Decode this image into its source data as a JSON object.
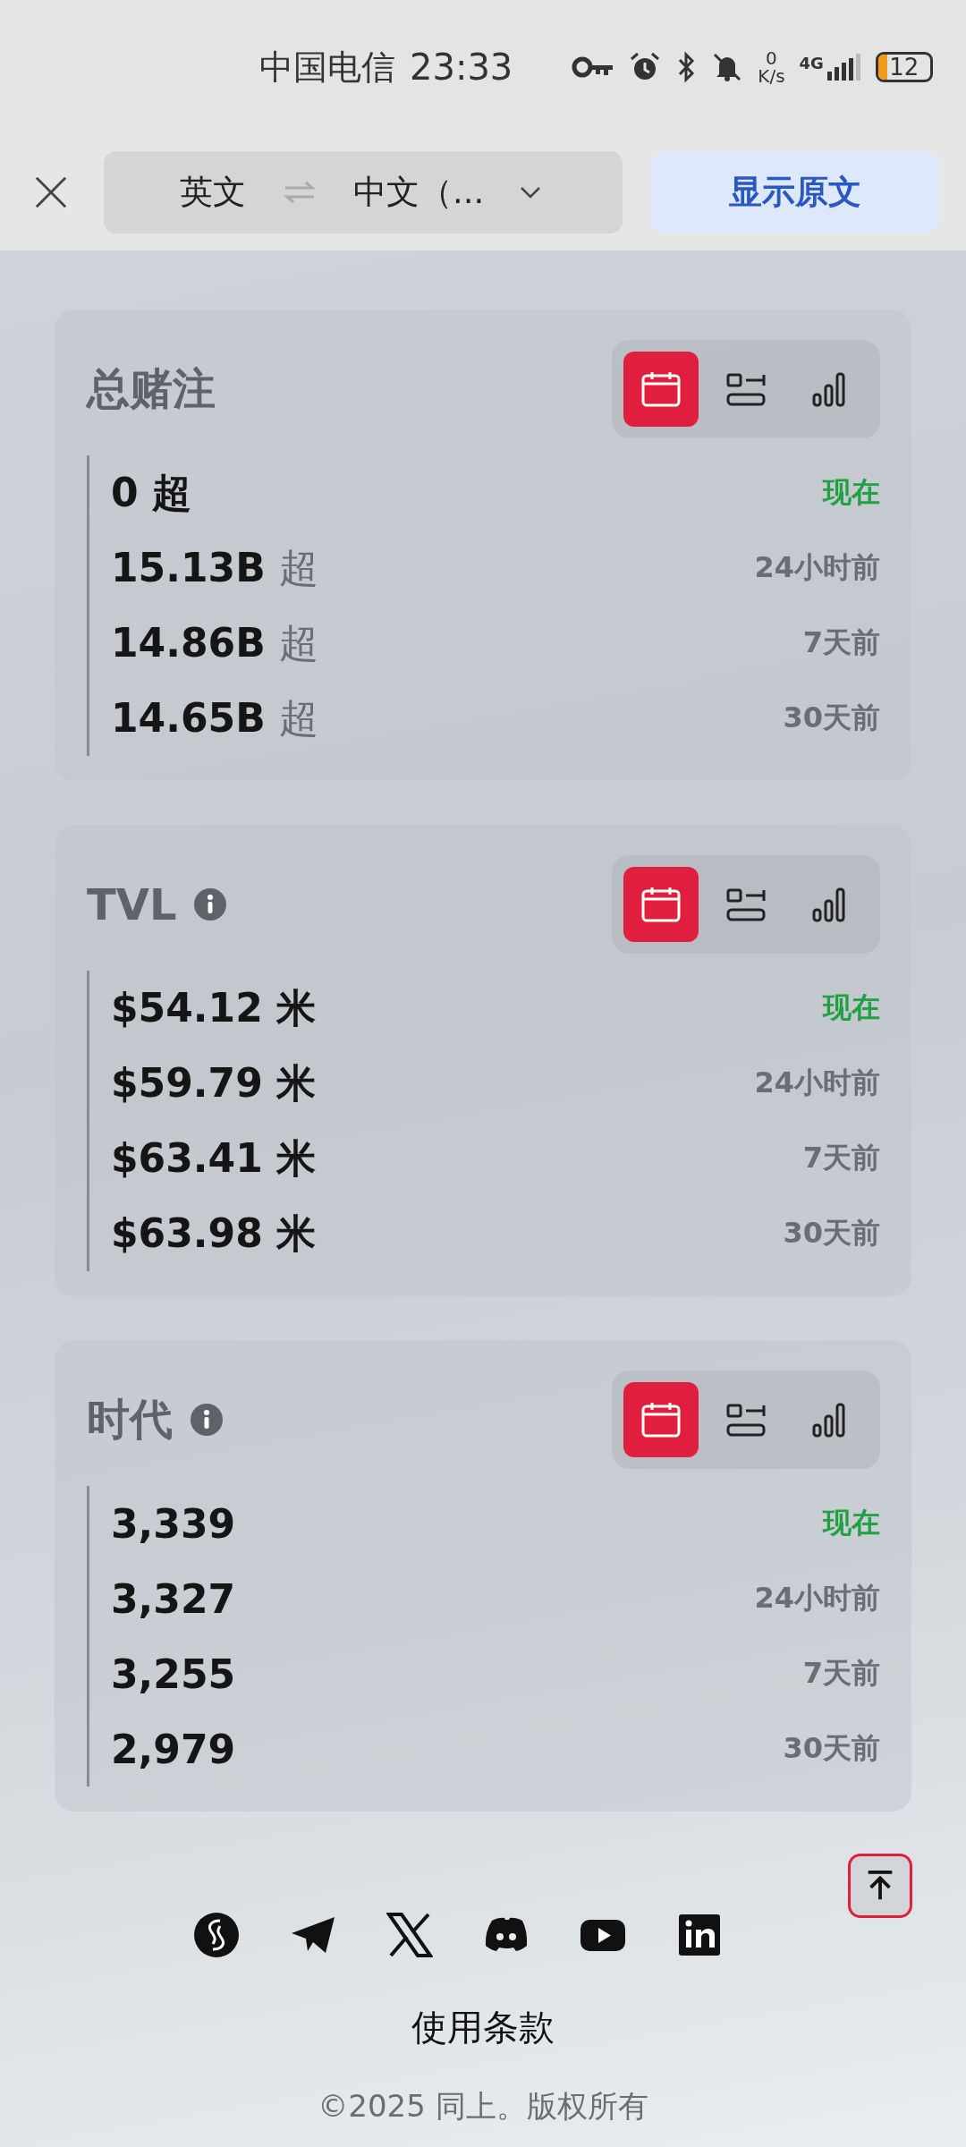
{
  "status_bar": {
    "carrier": "中国电信",
    "time": "23:33",
    "net_speed_value": "0",
    "net_speed_unit": "K/s",
    "network": "4G",
    "battery": "12"
  },
  "translate_bar": {
    "source_language": "英文",
    "target_language": "中文（...",
    "show_original_button": "显示原文"
  },
  "cards": [
    {
      "title": "总赌注",
      "info": false,
      "view_buttons": [
        {
          "selected": true
        },
        {
          "selected": false
        },
        {
          "selected": false
        }
      ],
      "rows": [
        {
          "value": "0",
          "unit": "超",
          "unit_muted": false,
          "time": "现在",
          "current": true
        },
        {
          "value": "15.13B",
          "unit": "超",
          "unit_muted": true,
          "time": "24小时前",
          "current": false
        },
        {
          "value": "14.86B",
          "unit": "超",
          "unit_muted": true,
          "time": "7天前",
          "current": false
        },
        {
          "value": "14.65B",
          "unit": "超",
          "unit_muted": true,
          "time": "30天前",
          "current": false
        }
      ]
    },
    {
      "title": "TVL",
      "info": true,
      "view_buttons": [
        {
          "selected": true
        },
        {
          "selected": false
        },
        {
          "selected": false
        }
      ],
      "rows": [
        {
          "value": "$54.12",
          "unit": "米",
          "unit_muted": false,
          "time": "现在",
          "current": true
        },
        {
          "value": "$59.79",
          "unit": "米",
          "unit_muted": false,
          "time": "24小时前",
          "current": false
        },
        {
          "value": "$63.41",
          "unit": "米",
          "unit_muted": false,
          "time": "7天前",
          "current": false
        },
        {
          "value": "$63.98",
          "unit": "米",
          "unit_muted": false,
          "time": "30天前",
          "current": false
        }
      ]
    },
    {
      "title": "时代",
      "info": true,
      "view_buttons": [
        {
          "selected": true
        },
        {
          "selected": false
        },
        {
          "selected": false
        }
      ],
      "rows": [
        {
          "value": "3,339",
          "time": "现在",
          "current": true
        },
        {
          "value": "3,327",
          "time": "24小时前",
          "current": false
        },
        {
          "value": "3,255",
          "time": "7天前",
          "current": false
        },
        {
          "value": "2,979",
          "time": "30天前",
          "current": false
        }
      ]
    }
  ],
  "social_links": [
    {
      "kind": "swirl"
    },
    {
      "kind": "telegram"
    },
    {
      "kind": "x"
    },
    {
      "kind": "discord"
    },
    {
      "kind": "youtube"
    },
    {
      "kind": "linkedin"
    }
  ],
  "footer": {
    "terms_link": "使用条款",
    "copyright": "©2025 同上。版权所有"
  }
}
